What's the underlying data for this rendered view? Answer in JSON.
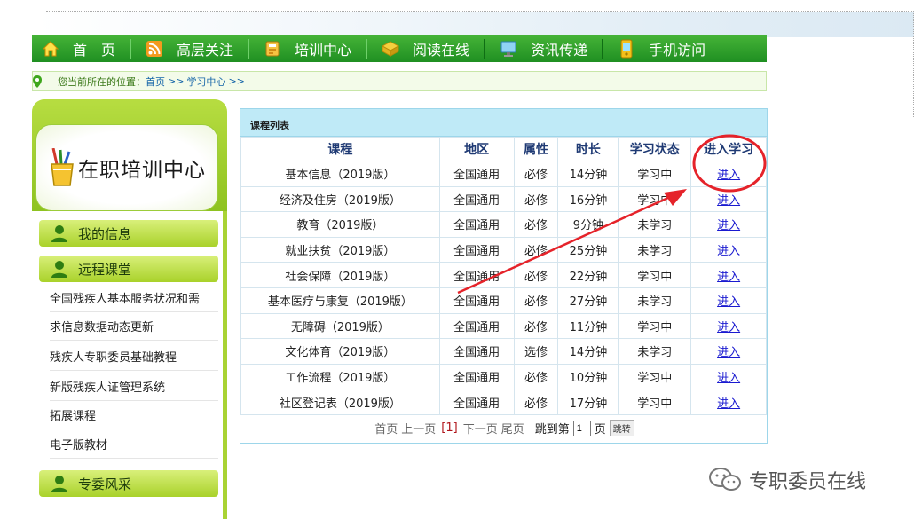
{
  "nav": {
    "items": [
      {
        "label": "首　页",
        "icon": "home-icon"
      },
      {
        "label": "高层关注",
        "icon": "rss-icon"
      },
      {
        "label": "培训中心",
        "icon": "training-icon"
      },
      {
        "label": "阅读在线",
        "icon": "reading-icon"
      },
      {
        "label": "资讯传递",
        "icon": "monitor-icon"
      },
      {
        "label": "手机访问",
        "icon": "mobile-icon"
      }
    ]
  },
  "breadcrumb": {
    "prefix": "您当前所在的位置：",
    "home": "首页",
    "sep1": ">>",
    "current": "学习中心",
    "sep2": ">>"
  },
  "sidebar": {
    "title": "在职培训中心",
    "menu": {
      "my_info": "我的信息",
      "remote": "远程课堂",
      "committee": "专委风采"
    },
    "sub_items": [
      "全国残疾人基本服务状况和需",
      "求信息数据动态更新",
      "残疾人专职委员基础教程",
      "新版残疾人证管理系统",
      "拓展课程",
      "电子版教材"
    ]
  },
  "course_list": {
    "title": "课程列表",
    "headers": [
      "课程",
      "地区",
      "属性",
      "时长",
      "学习状态",
      "进入学习"
    ],
    "rows": [
      [
        "基本信息（2019版）",
        "全国通用",
        "必修",
        "14分钟",
        "学习中",
        "进入"
      ],
      [
        "经济及住房（2019版）",
        "全国通用",
        "必修",
        "16分钟",
        "学习中",
        "进入"
      ],
      [
        "教育（2019版）",
        "全国通用",
        "必修",
        "9分钟",
        "未学习",
        "进入"
      ],
      [
        "就业扶贫（2019版）",
        "全国通用",
        "必修",
        "25分钟",
        "未学习",
        "进入"
      ],
      [
        "社会保障（2019版）",
        "全国通用",
        "必修",
        "22分钟",
        "学习中",
        "进入"
      ],
      [
        "基本医疗与康复（2019版）",
        "全国通用",
        "必修",
        "27分钟",
        "未学习",
        "进入"
      ],
      [
        "无障碍（2019版）",
        "全国通用",
        "必修",
        "11分钟",
        "学习中",
        "进入"
      ],
      [
        "文化体育（2019版）",
        "全国通用",
        "选修",
        "14分钟",
        "未学习",
        "进入"
      ],
      [
        "工作流程（2019版）",
        "全国通用",
        "必修",
        "10分钟",
        "学习中",
        "进入"
      ],
      [
        "社区登记表（2019版）",
        "全国通用",
        "必修",
        "17分钟",
        "学习中",
        "进入"
      ]
    ]
  },
  "pager": {
    "first": "首页",
    "prev": "上一页",
    "current": "[1]",
    "next": "下一页",
    "last": "尾页",
    "goto_prefix": "跳到第",
    "page_value": "1",
    "goto_suffix": "页",
    "go_button": "跳转"
  },
  "watermark": {
    "text": "专职委员在线",
    "icon": "wechat-icon"
  },
  "colors": {
    "nav_green": "#1f8f22",
    "sidebar_green": "#a9d334",
    "table_header_bg": "#bfeaf7",
    "annotation_red": "#e5232a"
  }
}
